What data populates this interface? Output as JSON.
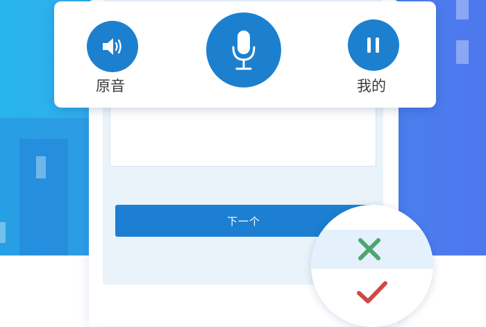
{
  "controls": {
    "original_sound_label": "原音",
    "mine_label": "我的"
  },
  "main": {
    "next_button_label": "下一个"
  },
  "colors": {
    "accent": "#1d80cf",
    "correct": "#4fa56e",
    "wrong": "#d04a44"
  },
  "icons": {
    "original_sound": "speaker-icon",
    "record": "microphone-icon",
    "mine": "pause-icon",
    "reject": "cross-icon",
    "accept": "checkmark-icon"
  }
}
